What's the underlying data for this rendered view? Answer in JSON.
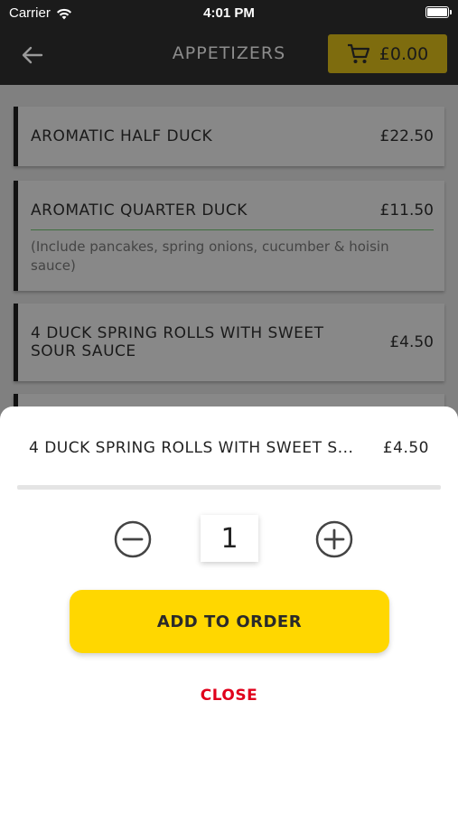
{
  "status_bar": {
    "carrier": "Carrier",
    "time": "4:01 PM"
  },
  "nav": {
    "title": "APPETIZERS",
    "cart_total": "£0.00"
  },
  "menu": {
    "items": [
      {
        "name": "AROMATIC HALF DUCK",
        "price": "£22.50"
      },
      {
        "name": "AROMATIC QUARTER DUCK",
        "price": "£11.50",
        "description": "(Include pancakes, spring onions, cucumber & hoisin sauce)"
      },
      {
        "name": "4 DUCK SPRING ROLLS WITH SWEET SOUR SAUCE",
        "price": "£4.50"
      }
    ]
  },
  "sheet": {
    "item_name": "4 DUCK SPRING ROLLS WITH SWEET S...",
    "item_price": "£4.50",
    "quantity": "1",
    "add_label": "ADD TO ORDER",
    "close_label": "CLOSE"
  },
  "colors": {
    "accent": "#ffd700",
    "close": "#e0001b",
    "nav_bg": "#1b1b1b"
  }
}
